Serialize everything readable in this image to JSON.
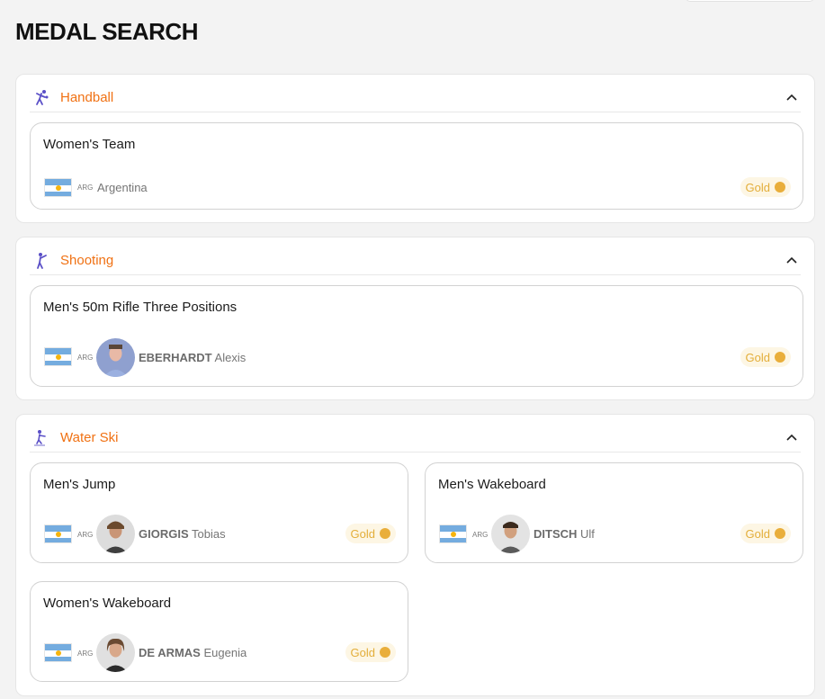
{
  "page": {
    "title": "MEDAL SEARCH"
  },
  "colors": {
    "sport_name": "#f07113",
    "gold": "#e9ae3b",
    "sport_icon": "#5a4fc7"
  },
  "sports": [
    {
      "name": "Handball",
      "icon": "handball-icon",
      "events": [
        {
          "name": "Women's Team",
          "noc": "ARG",
          "country": "Argentina",
          "medal": "Gold"
        }
      ]
    },
    {
      "name": "Shooting",
      "icon": "shooting-icon",
      "events": [
        {
          "name": "Men's 50m Rifle Three Positions",
          "noc": "ARG",
          "last_name": "EBERHARDT",
          "first_name": "Alexis",
          "medal": "Gold"
        }
      ]
    },
    {
      "name": "Water Ski",
      "icon": "water-ski-icon",
      "events": [
        {
          "name": "Men's Jump",
          "noc": "ARG",
          "last_name": "GIORGIS",
          "first_name": "Tobias",
          "medal": "Gold"
        },
        {
          "name": "Men's Wakeboard",
          "noc": "ARG",
          "last_name": "DITSCH",
          "first_name": "Ulf",
          "medal": "Gold"
        },
        {
          "name": "Women's Wakeboard",
          "noc": "ARG",
          "last_name": "DE ARMAS",
          "first_name": "Eugenia",
          "medal": "Gold"
        }
      ]
    }
  ]
}
